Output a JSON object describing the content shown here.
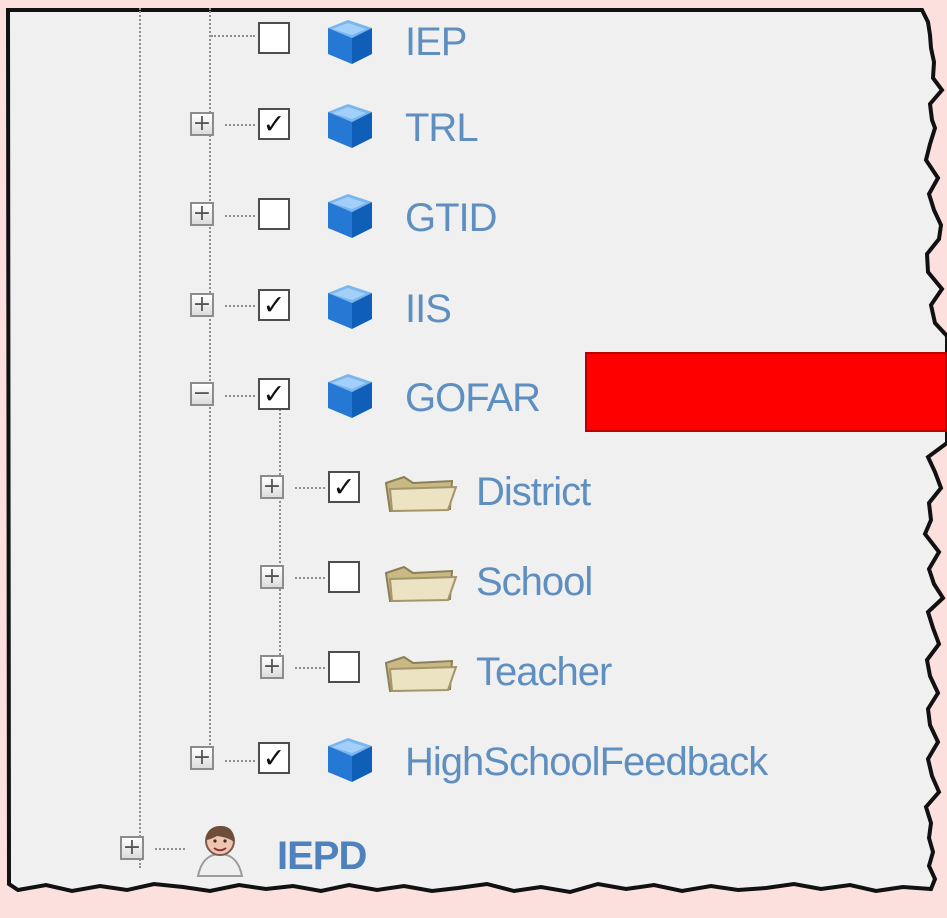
{
  "tree": {
    "items": [
      {
        "label": "IEP",
        "type": "cube",
        "checked": false,
        "expander": "",
        "icon": "blue-cube-icon"
      },
      {
        "label": "TRL",
        "type": "cube",
        "checked": true,
        "expander": "+",
        "icon": "blue-cube-icon"
      },
      {
        "label": "GTID",
        "type": "cube",
        "checked": false,
        "expander": "+",
        "icon": "blue-cube-icon"
      },
      {
        "label": "IIS",
        "type": "cube",
        "checked": true,
        "expander": "+",
        "icon": "blue-cube-icon"
      },
      {
        "label": "GOFAR",
        "type": "cube",
        "checked": true,
        "expander": "−",
        "icon": "blue-cube-icon"
      },
      {
        "label": "District",
        "type": "folder",
        "checked": true,
        "expander": "+",
        "icon": "folder-icon"
      },
      {
        "label": "School",
        "type": "folder",
        "checked": false,
        "expander": "+",
        "icon": "folder-icon"
      },
      {
        "label": "Teacher",
        "type": "folder",
        "checked": false,
        "expander": "+",
        "icon": "folder-icon"
      },
      {
        "label": "HighSchoolFeedback",
        "type": "cube",
        "checked": true,
        "expander": "+",
        "icon": "blue-cube-icon"
      },
      {
        "label": "IEPD",
        "type": "user",
        "checked": false,
        "expander": "+",
        "icon": "user-icon"
      }
    ]
  },
  "colors": {
    "label": "#5e8fc0",
    "highlight": "#ff0000",
    "background": "#f0f0f0"
  }
}
